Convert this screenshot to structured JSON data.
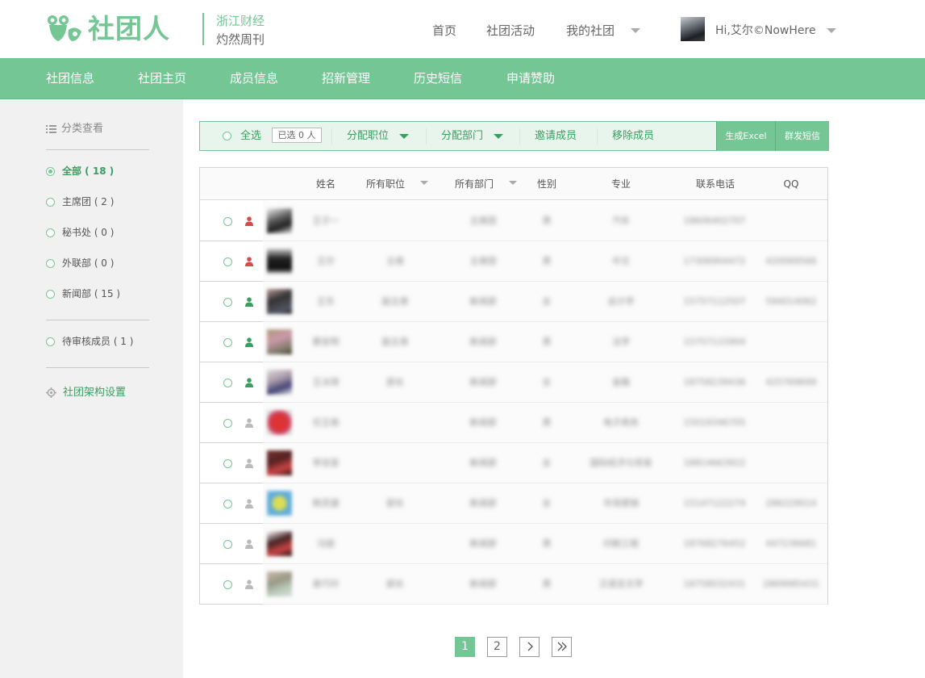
{
  "header": {
    "brand": "社团人",
    "org_name": "浙江财经",
    "org_sub": "灼然周刊",
    "nav": [
      "首页",
      "社团活动",
      "我的社团"
    ],
    "username": "Hi,艾尔©NowHere"
  },
  "mainnav": [
    "社团信息",
    "社团主页",
    "成员信息",
    "招新管理",
    "历史短信",
    "申请赞助"
  ],
  "sidebar": {
    "title": "分类查看",
    "groups": [
      {
        "label": "全部 ( 18 )",
        "active": true
      },
      {
        "label": "主席团 ( 2 )",
        "active": false
      },
      {
        "label": "秘书处 ( 0 )",
        "active": false
      },
      {
        "label": "外联部 ( 0 )",
        "active": false
      },
      {
        "label": "新闻部 ( 15 )",
        "active": false
      }
    ],
    "pending": "待审核成员 ( 1 )",
    "settings": "社团架构设置"
  },
  "toolbar": {
    "select_all": "全选",
    "selected": "已选 0 人",
    "assign_position": "分配职位",
    "assign_department": "分配部门",
    "invite": "邀请成员",
    "remove": "移除成员",
    "excel": "生成Excel",
    "sms": "群发短信"
  },
  "table": {
    "headers": [
      "姓名",
      "所有职位",
      "所有部门",
      "性别",
      "专业",
      "联系电话",
      "QQ"
    ],
    "rows": [
      {
        "role": "leader",
        "name": "王子一",
        "position": "",
        "dept": "主席团",
        "gender": "男",
        "major": "汽车",
        "phone": "18606402707",
        "qq": ""
      },
      {
        "role": "leader",
        "name": "王尔",
        "position": "主席",
        "dept": "主席团",
        "gender": "男",
        "major": "中文",
        "phone": "17306904472",
        "qq": "420069566"
      },
      {
        "role": "member",
        "name": "王东",
        "position": "副主席",
        "dept": "新闻部",
        "gender": "女",
        "major": "会计学",
        "phone": "15757112507",
        "qq": "594014062"
      },
      {
        "role": "member",
        "name": "蔡安明",
        "position": "副主席",
        "dept": "新闻部",
        "gender": "男",
        "major": "法学",
        "phone": "15757115904",
        "qq": ""
      },
      {
        "role": "member",
        "name": "王冰琪",
        "position": "部长",
        "dept": "新闻部",
        "gender": "女",
        "major": "金融",
        "phone": "18758239436",
        "qq": "425769699"
      },
      {
        "role": "normal",
        "name": "任王南",
        "position": "",
        "dept": "新闻部",
        "gender": "男",
        "major": "电子商务",
        "phone": "15019346705",
        "qq": ""
      },
      {
        "role": "normal",
        "name": "李佳音",
        "position": "",
        "dept": "新闻部",
        "gender": "女",
        "major": "国际经济与贸易",
        "phone": "18814663922",
        "qq": ""
      },
      {
        "role": "normal",
        "name": "韩灵捷",
        "position": "部长",
        "dept": "新闻部",
        "gender": "女",
        "major": "市场营销",
        "phone": "15147122274",
        "qq": "286229014"
      },
      {
        "role": "normal",
        "name": "冯丽",
        "position": "",
        "dept": "新闻部",
        "gender": "男",
        "major": "印刷工程",
        "phone": "18768276452",
        "qq": "447236681"
      },
      {
        "role": "normal",
        "name": "章巧玲",
        "position": "部长",
        "dept": "新闻部",
        "gender": "男",
        "major": "汉语言文学",
        "phone": "18758032431",
        "qq": "2869985431"
      }
    ]
  },
  "pagination": {
    "pages": [
      "1",
      "2"
    ],
    "current": "1"
  },
  "colors": {
    "brand_green": "#74c694",
    "leader_red": "#d64a4a",
    "member_green": "#3a9e60",
    "normal_gray": "#bbbbbb"
  },
  "icons": [
    "list-icon",
    "gear-icon",
    "person-icon",
    "chevron-right-icon",
    "double-chevron-right-icon"
  ]
}
